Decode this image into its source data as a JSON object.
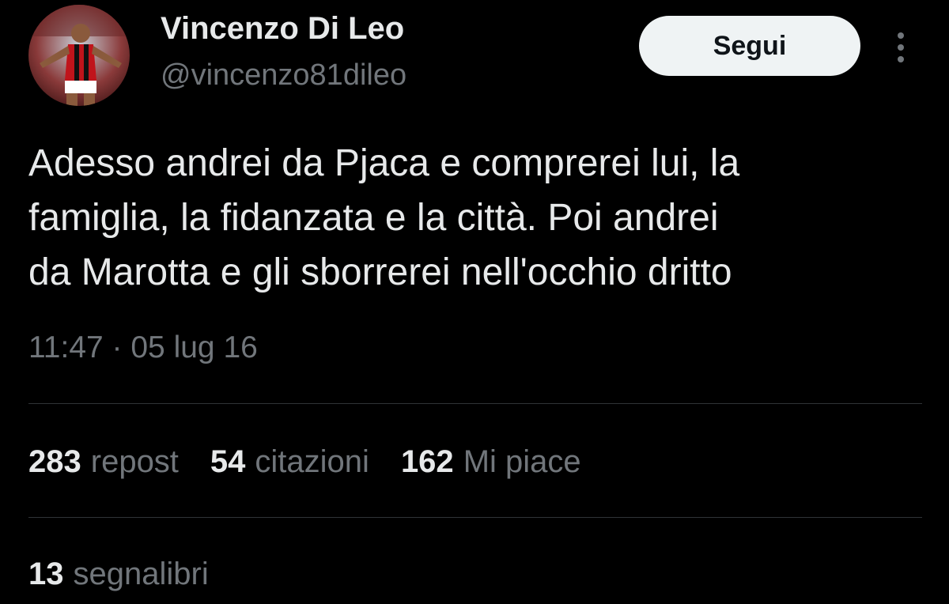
{
  "author": {
    "display_name": "Vincenzo Di Leo",
    "handle": "@vincenzo81dileo"
  },
  "follow_button": {
    "label": "Segui"
  },
  "more_menu": {
    "icon": "more-vertical-icon"
  },
  "tweet": {
    "text_lines": [
      "Adesso andrei da Pjaca e comprerei lui, la",
      "famiglia, la fidanzata e la città. Poi andrei",
      "da Marotta e gli sborrerei nell'occhio dritto"
    ],
    "timestamp": "11:47 · 05 lug 16"
  },
  "stats": {
    "reposts": {
      "count": "283",
      "label": "repost"
    },
    "quotes": {
      "count": "54",
      "label": "citazioni"
    },
    "likes": {
      "count": "162",
      "label": "Mi piace"
    },
    "bookmarks": {
      "count": "13",
      "label": "segnalibri"
    }
  },
  "colors": {
    "background": "#000000",
    "primary_text": "#e7e9ea",
    "secondary_text": "#71767b",
    "divider": "#2f3336",
    "button_bg": "#eff3f4",
    "button_text": "#0f1419"
  }
}
